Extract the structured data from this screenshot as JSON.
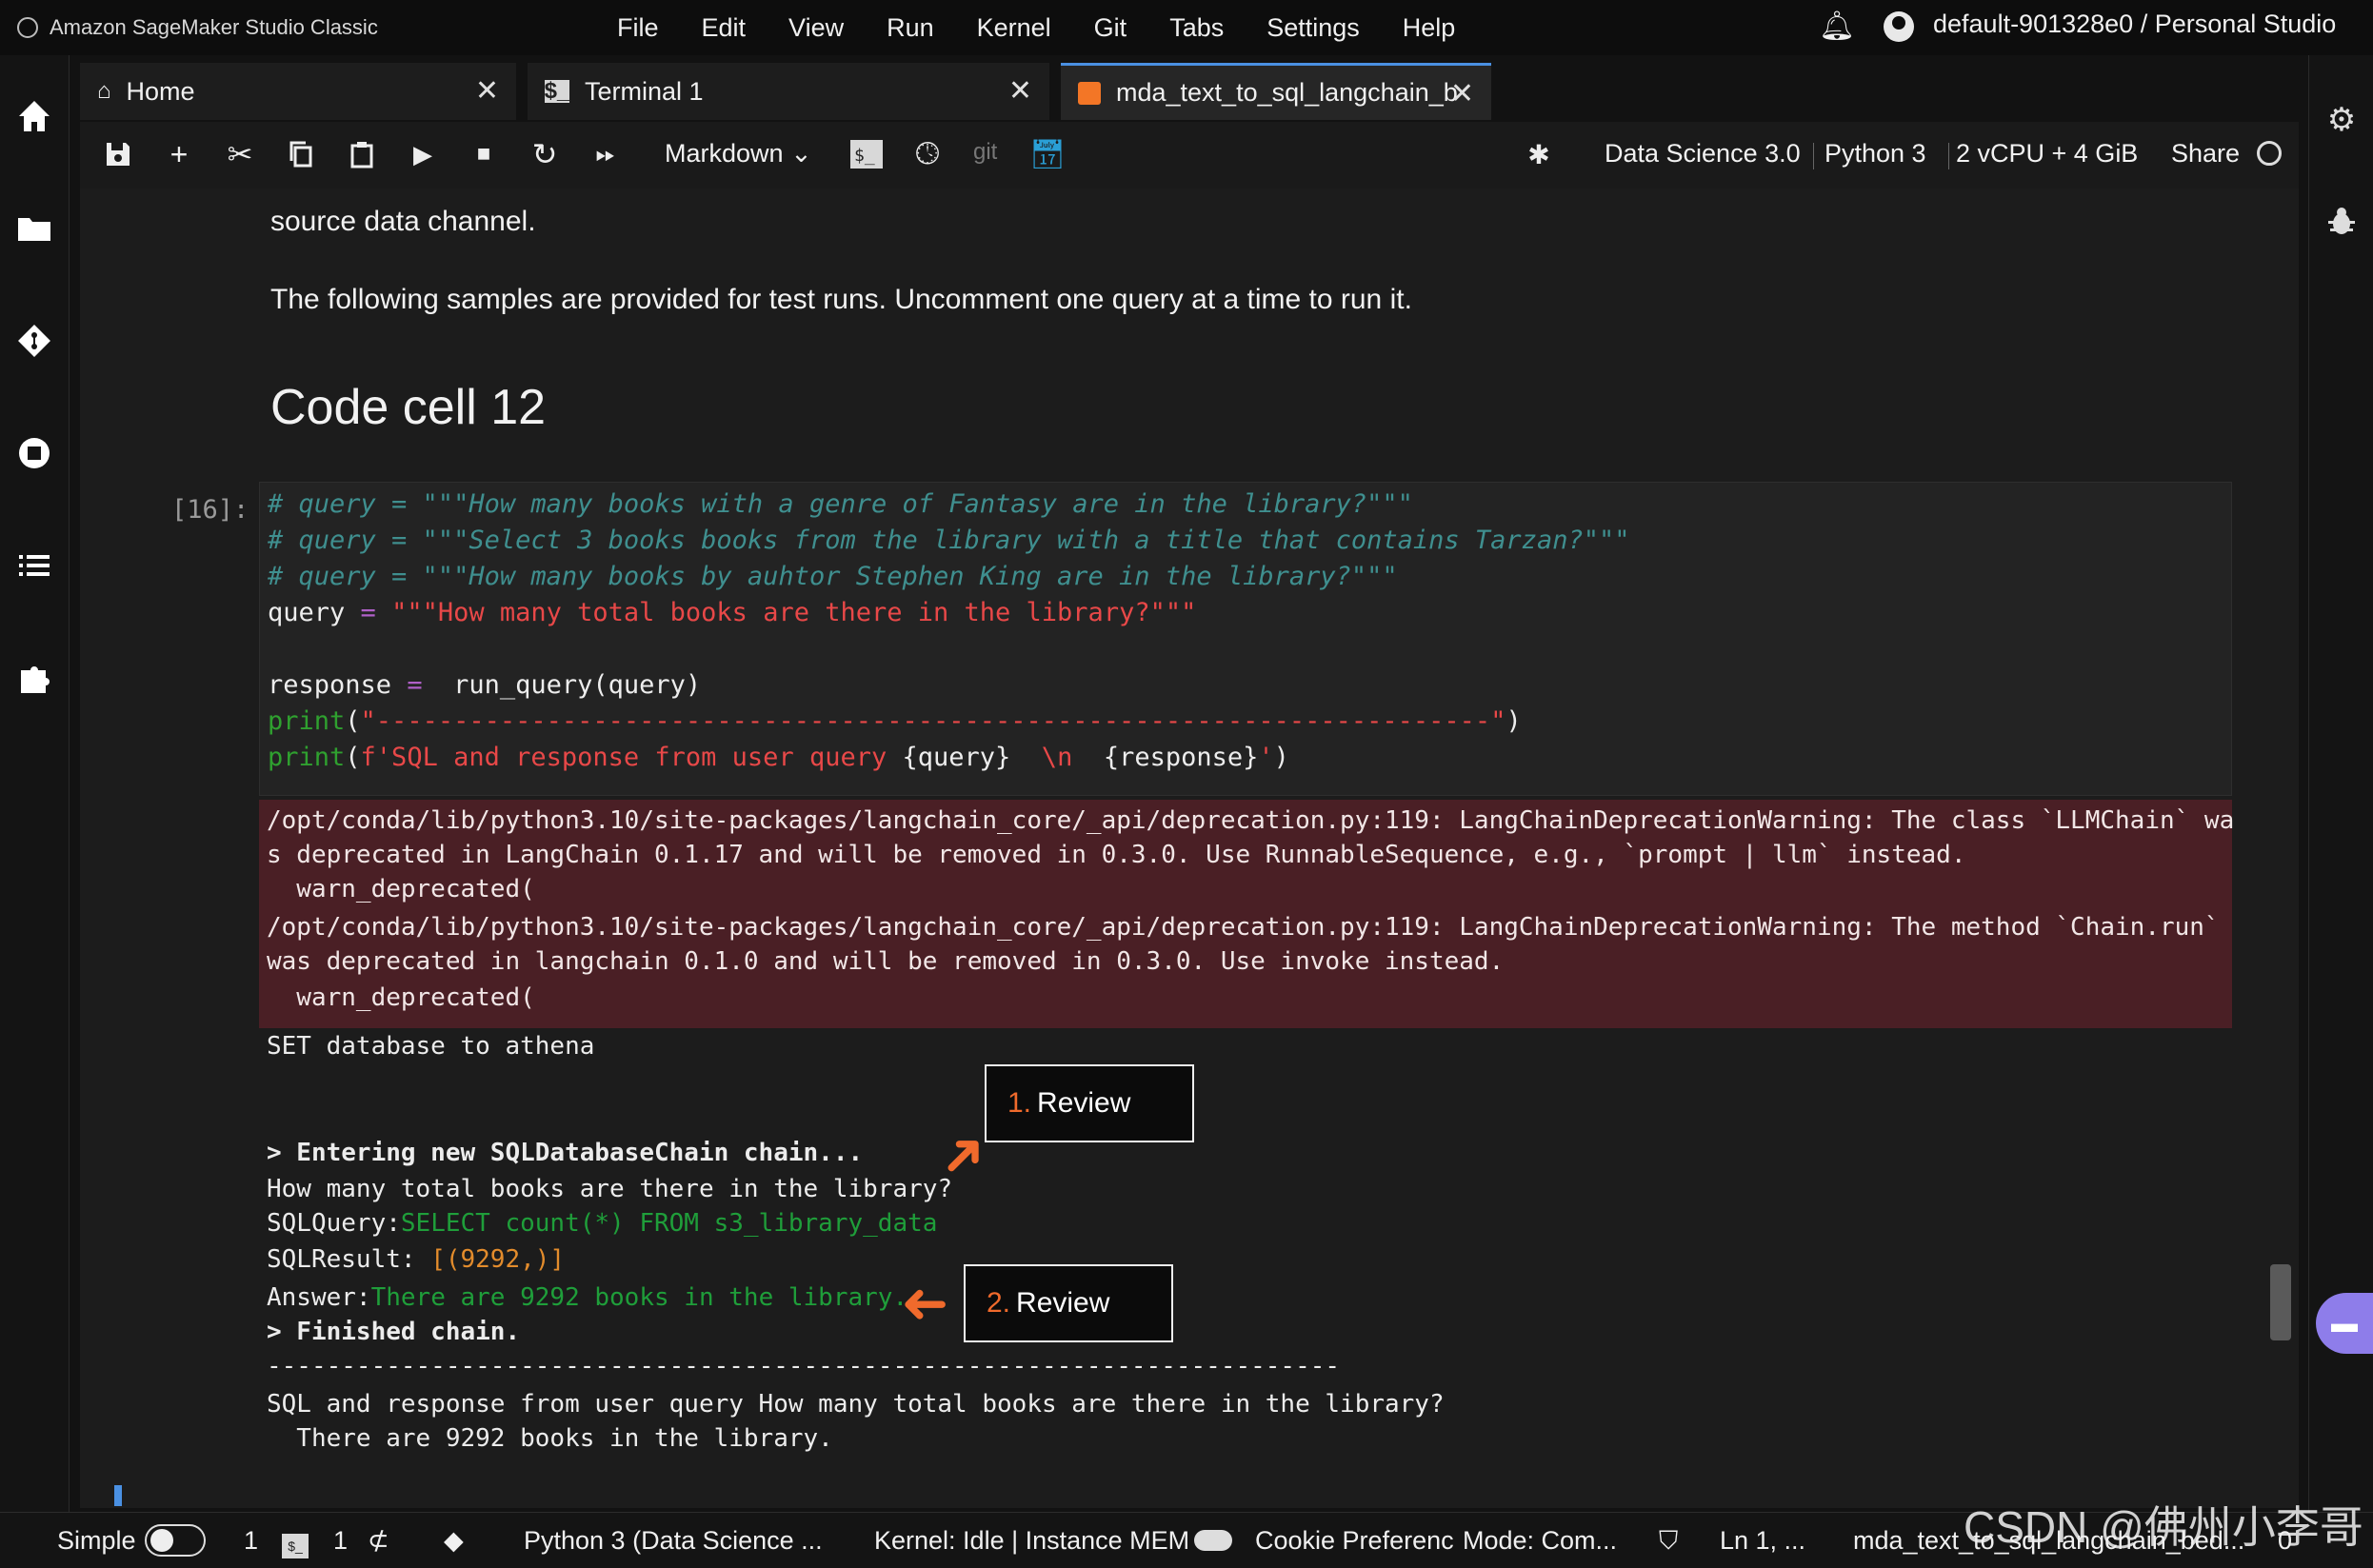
{
  "app": {
    "title": "Amazon SageMaker Studio Classic",
    "menus": [
      "File",
      "Edit",
      "View",
      "Run",
      "Kernel",
      "Git",
      "Tabs",
      "Settings",
      "Help"
    ],
    "user": "default-901328e0 / Personal Studio"
  },
  "tabs": [
    {
      "label": "Home",
      "icon": "home-icon"
    },
    {
      "label": "Terminal 1",
      "icon": "terminal-icon"
    },
    {
      "label": "mda_text_to_sql_langchain_b",
      "icon": "notebook-icon",
      "active": true
    }
  ],
  "toolbar": {
    "cell_type": "Markdown",
    "git_label": "git",
    "image": "Data Science 3.0",
    "kernel": "Python 3",
    "instance": "2 vCPU + 4 GiB",
    "share": "Share"
  },
  "notebook": {
    "md_line1": "source data channel.",
    "md_line2": "The following samples are provided for test runs. Uncomment one query at a time to run it.",
    "heading": "Code cell 12",
    "prompt": "[16]:",
    "code": {
      "c1": "# query = \"\"\"How many books with a genre of Fantasy are in the library?\"\"\"",
      "c2": "# query = \"\"\"Select 3 books books from the library with a title that contains Tarzan?\"\"\"",
      "c3": "# query = \"\"\"How many books by auhtor Stephen King are in the library?\"\"\"",
      "q_var": "query ",
      "q_eq": "=",
      "q_str": " \"\"\"How many total books are there in the library?\"\"\"",
      "r_var": "response ",
      "r_eq": "=",
      "r_call": "  run_query(query)",
      "p1_fn": "print",
      "p1_open": "(",
      "p1_str": "\"------------------------------------------------------------------------\"",
      "p1_close": ")",
      "p2_fn": "print",
      "p2_open": "(",
      "p2_str1": "f'SQL and response from user query ",
      "p2_var1": "{query}",
      "p2_str2": "  \\n  ",
      "p2_var2": "{response}",
      "p2_str3": "'",
      "p2_close": ")"
    },
    "stderr": [
      "/opt/conda/lib/python3.10/site-packages/langchain_core/_api/deprecation.py:119: LangChainDeprecationWarning: The class `LLMChain` wa",
      "s deprecated in LangChain 0.1.17 and will be removed in 0.3.0. Use RunnableSequence, e.g., `prompt | llm` instead.",
      "  warn_deprecated(",
      "/opt/conda/lib/python3.10/site-packages/langchain_core/_api/deprecation.py:119: LangChainDeprecationWarning: The method `Chain.run`",
      "was deprecated in langchain 0.1.0 and will be removed in 0.3.0. Use invoke instead.",
      "  warn_deprecated("
    ],
    "output": {
      "set_db": "SET database to athena",
      "entering": "> Entering new SQLDatabaseChain chain...",
      "question": "How many total books are there in the library?",
      "sqlquery_label": "SQLQuery:",
      "sqlquery_value": "SELECT count(*) FROM s3_library_data",
      "sqlresult_label": "SQLResult: ",
      "sqlresult_value": "[(9292,)]",
      "answer_label": "Answer:",
      "answer_value": "There are 9292 books in the library.",
      "finished": "> Finished chain.",
      "dashes": "------------------------------------------------------------------------",
      "final1": "SQL and response from user query How many total books are there in the library?",
      "final2": "  There are 9292 books in the library."
    },
    "callouts": [
      {
        "num": "1.",
        "text": "Review"
      },
      {
        "num": "2.",
        "text": "Review"
      }
    ]
  },
  "statusbar": {
    "mode": "Simple",
    "count1": "1",
    "count2": "1",
    "kernel_name": "Python 3 (Data Science ...",
    "kernel_status": "Kernel: Idle | Instance MEM",
    "cookie": "Cookie Preferenc",
    "edit_mode": "Mode: Com...",
    "position": "Ln 1, ...",
    "filename": "mda_text_to_sql_langchain_bed...",
    "count3": "0"
  },
  "watermark": "CSDN @佛州小李哥",
  "colors": {
    "accent": "#4a90e2",
    "callout_arrow": "#f06a2c",
    "stderr_bg": "#4a1f25"
  }
}
